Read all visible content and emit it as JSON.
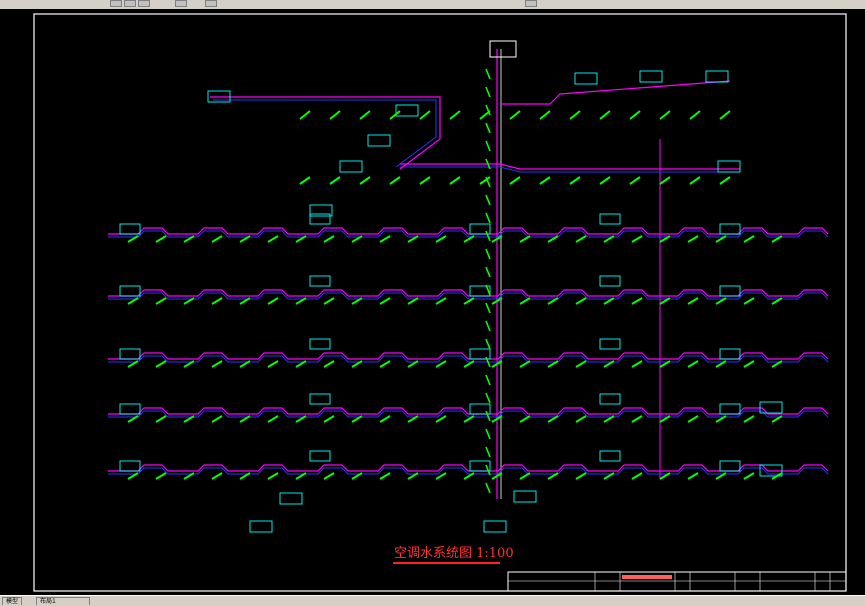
{
  "drawing": {
    "title": "空调水系统图 1:100"
  },
  "statusbar": {
    "tabs": [
      "模型",
      "布局1"
    ]
  },
  "colors": {
    "background": "#000000",
    "frame": "#ffffff",
    "supply_pipe": "#ff00ff",
    "return_pipe": "#3030ff",
    "equipment": "#00ffff",
    "labels": "#00ff00",
    "title": "#ff3030"
  }
}
